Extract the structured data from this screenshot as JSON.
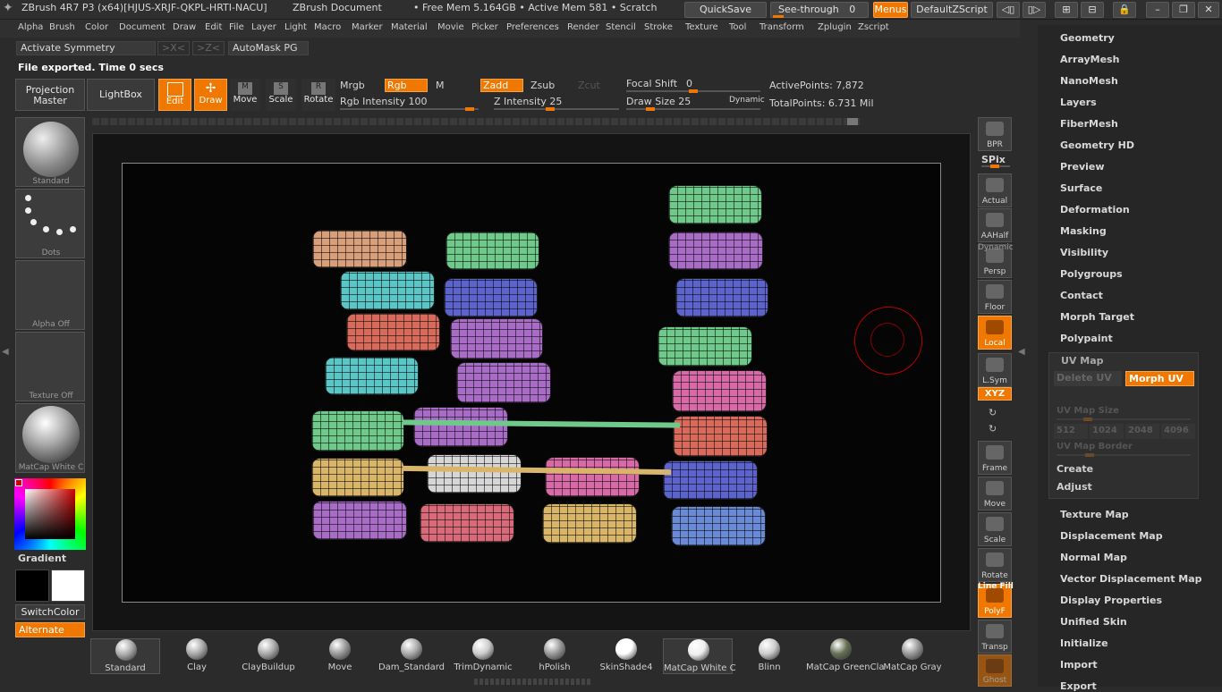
{
  "title": {
    "app": "ZBrush 4R7 P3 (x64)[HJUS-XRJF-QKPL-HRTI-NACU]",
    "doc": "ZBrush Document",
    "mem": "• Free Mem 5.164GB • Active Mem 581 • Scratch",
    "quicksave": "QuickSave",
    "seethrough": "See-through",
    "seethrough_val": "0",
    "menus": "Menus",
    "script": "DefaultZScript"
  },
  "menus": [
    "Alpha",
    "Brush",
    "Color",
    "Document",
    "Draw",
    "Edit",
    "File",
    "Layer",
    "Light",
    "Macro",
    "Marker",
    "Material",
    "Movie",
    "Picker",
    "Preferences",
    "Render",
    "Stencil",
    "Stroke",
    "Texture",
    "Tool",
    "Transform",
    "Zplugin",
    "Zscript"
  ],
  "symmetry": {
    "activate": "Activate Symmetry",
    "x": ">X<",
    "z": ">Z<",
    "automask": "AutoMask PG"
  },
  "status_text": "File exported. Time 0 secs",
  "toolbar": {
    "projection": "Projection Master",
    "lightbox": "LightBox",
    "edit": "Edit",
    "draw": "Draw",
    "move": "Move",
    "scale": "Scale",
    "rotate": "Rotate",
    "mrgb": "Mrgb",
    "rgb": "Rgb",
    "m": "M",
    "zadd": "Zadd",
    "zsub": "Zsub",
    "zcut": "Zcut",
    "rgb_intensity": "Rgb Intensity 100",
    "z_intensity": "Z Intensity 25",
    "focal_shift": "Focal Shift",
    "focal_val": "0",
    "draw_size": "Draw Size 25",
    "dynamic": "Dynamic",
    "active_points": "ActivePoints: 7,872",
    "total_points": "TotalPoints: 6.731 Mil"
  },
  "left": {
    "standard": "Standard",
    "dots": "Dots",
    "alpha": "Alpha Off",
    "texture": "Texture Off",
    "matcap": "MatCap White C",
    "gradient": "Gradient",
    "switchcolor": "SwitchColor",
    "alternate": "Alternate"
  },
  "right_tools": {
    "bpr": "BPR",
    "spix": "SPix",
    "actual": "Actual",
    "aahalf": "AAHalf",
    "dynamic": "Dynamic",
    "persp": "Persp",
    "floor": "Floor",
    "local": "Local",
    "lsym": "L.Sym",
    "xyz": "XYZ",
    "frame": "Frame",
    "move": "Move",
    "scale": "Scale",
    "rotate": "Rotate",
    "linefill": "Line Fill",
    "polyf": "PolyF",
    "transp": "Transp",
    "ghost": "Ghost"
  },
  "palette": {
    "items_top": [
      "Geometry",
      "ArrayMesh",
      "NanoMesh",
      "Layers",
      "FiberMesh",
      "Geometry HD",
      "Preview",
      "Surface",
      "Deformation",
      "Masking",
      "Visibility",
      "Polygroups",
      "Contact",
      "Morph Target",
      "Polypaint"
    ],
    "uvmap": {
      "title": "UV Map",
      "delete": "Delete UV",
      "morph": "Morph UV",
      "size_label": "UV Map Size",
      "sizes": [
        "512",
        "1024",
        "2048",
        "4096"
      ],
      "border": "UV Map Border",
      "create": "Create",
      "adjust": "Adjust"
    },
    "items_bottom": [
      "Texture Map",
      "Displacement Map",
      "Normal Map",
      "Vector Displacement Map",
      "Display Properties",
      "Unified Skin",
      "Initialize",
      "Import",
      "Export"
    ]
  },
  "shelf": [
    "Standard",
    "Clay",
    "ClayBuildup",
    "Move",
    "Dam_Standard",
    "TrimDynamic",
    "hPolish",
    "SkinShade4",
    "MatCap White C",
    "Blinn",
    "MatCap GreenCla",
    "MatCap Gray"
  ],
  "colors": {
    "accent": "#f07800",
    "bg": "#2b2b2b",
    "panel": "#262626"
  }
}
